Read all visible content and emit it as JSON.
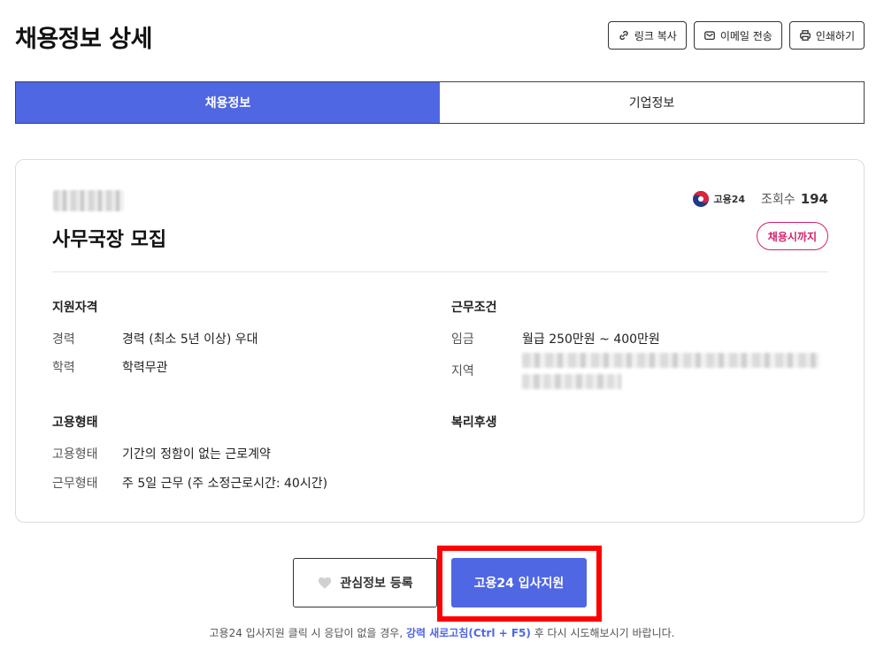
{
  "header": {
    "title": "채용정보 상세",
    "actions": [
      {
        "label": "링크 복사",
        "icon": "link-icon"
      },
      {
        "label": "이메일 전송",
        "icon": "mail-icon"
      },
      {
        "label": "인쇄하기",
        "icon": "printer-icon"
      }
    ]
  },
  "tabs": [
    {
      "label": "채용정보",
      "active": true
    },
    {
      "label": "기업정보",
      "active": false
    }
  ],
  "job": {
    "title": "사무국장 모집",
    "source_label": "고용24",
    "views_label": "조회수",
    "views_count": "194",
    "deadline_badge": "채용시까지"
  },
  "sections": {
    "qualification": {
      "title": "지원자격",
      "rows": [
        {
          "label": "경력",
          "value": "경력 (최소 5년 이상) 우대"
        },
        {
          "label": "학력",
          "value": "학력무관"
        }
      ]
    },
    "conditions": {
      "title": "근무조건",
      "rows": [
        {
          "label": "임금",
          "value": "월급 250만원 ~ 400만원"
        },
        {
          "label": "지역",
          "value": ""
        }
      ]
    },
    "employment": {
      "title": "고용형태",
      "rows": [
        {
          "label": "고용형태",
          "value": "기간의 정함이 없는 근로계약"
        },
        {
          "label": "근무형태",
          "value": "주 5일 근무 (주 소정근로시간: 40시간)"
        }
      ]
    },
    "welfare": {
      "title": "복리후생"
    }
  },
  "buttons": {
    "favorite": "관심정보 등록",
    "apply": "고용24 입사지원"
  },
  "notice": {
    "before": "고용24 입사지원 클릭 시 응답이 없을 경우, ",
    "strong": "강력 새로고침(Ctrl + F5)",
    "after": " 후 다시 시도해보시기 바랍니다."
  },
  "colors": {
    "primary": "#4f67e3",
    "badge": "#d2236b",
    "highlight": "#ff0000"
  }
}
